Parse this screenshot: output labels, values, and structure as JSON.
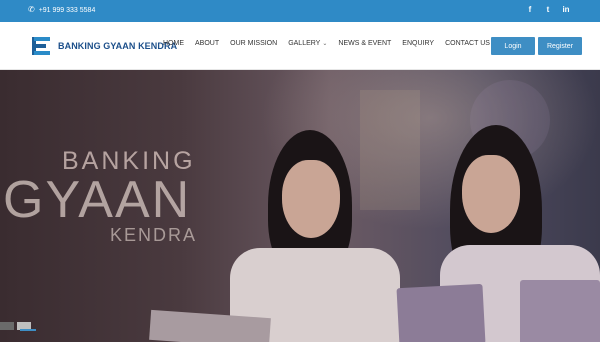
{
  "topbar": {
    "phone": "+91 999 333 5584",
    "phone_icon": "phone-icon",
    "social": [
      {
        "name": "facebook-icon",
        "glyph": "f"
      },
      {
        "name": "twitter-icon",
        "glyph": "t"
      },
      {
        "name": "linkedin-icon",
        "glyph": "in"
      }
    ],
    "bg_color": "#2f8ac6"
  },
  "header": {
    "logo_text": "BANKING GYAAN KENDRA",
    "nav": [
      {
        "label": "HOME"
      },
      {
        "label": "ABOUT"
      },
      {
        "label": "OUR MISSION"
      },
      {
        "label": "GALLERY",
        "dropdown": true
      },
      {
        "label": "NEWS & EVENT"
      },
      {
        "label": "ENQUIRY"
      },
      {
        "label": "CONTACT US"
      }
    ],
    "login_label": "Login",
    "register_label": "Register",
    "button_color": "#3e8ec4"
  },
  "hero": {
    "line1": "BANKING",
    "line2": "GYAAN",
    "line3": "KENDRA"
  }
}
